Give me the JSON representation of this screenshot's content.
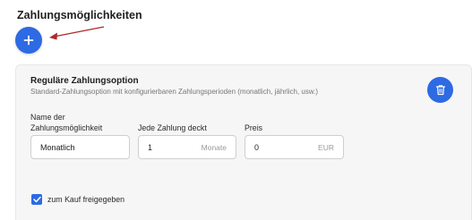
{
  "section": {
    "title": "Zahlungsmöglichkeiten",
    "add_icon": "plus-icon",
    "annotation_icon": "arrow-pointer",
    "annotation_color": "#b0292a"
  },
  "option": {
    "title": "Reguläre Zahlungsoption",
    "description": "Standard-Zahlungsoption mit konfigurierbaren Zahlungsperioden (monatlich, jährlich, usw.)",
    "delete_icon": "trash-icon",
    "fields": {
      "name": {
        "label": "Name der Zahlungsmöglichkeit",
        "value": "Monatlich"
      },
      "covers": {
        "label": "Jede Zahlung deckt",
        "value": "1",
        "unit": "Monate"
      },
      "price": {
        "label": "Preis",
        "value": "0",
        "unit": "EUR"
      }
    },
    "purchasable": {
      "label": "zum Kauf freigegeben",
      "checked": true
    }
  },
  "colors": {
    "accent": "#2d6ae3",
    "card_bg": "#f6f6f6"
  }
}
